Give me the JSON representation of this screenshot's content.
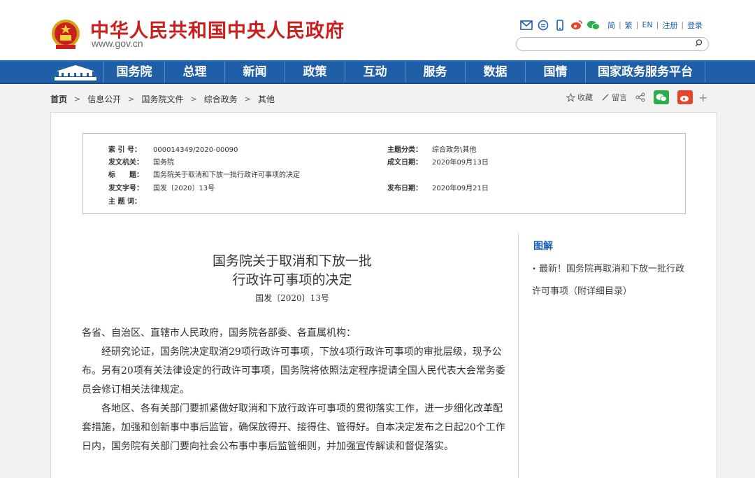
{
  "header": {
    "title": "中华人民共和国中央人民政府",
    "url": "www.gov.cn",
    "lang_links": [
      "简",
      "繁",
      "EN",
      "注册",
      "登录"
    ],
    "search_placeholder": ""
  },
  "nav": {
    "items": [
      "国务院",
      "总理",
      "新闻",
      "政策",
      "互动",
      "服务",
      "数据",
      "国情",
      "国家政务服务平台"
    ]
  },
  "breadcrumb": {
    "items": [
      "首页",
      "信息公开",
      "国务院文件",
      "综合政务",
      "其他"
    ]
  },
  "tools": {
    "favorite": "收藏",
    "comment": "留言"
  },
  "meta": {
    "index_no_label": "索 引 号：",
    "index_no": "000014349/2020-00090",
    "topic_label": "主题分类：",
    "topic": "综合政务\\其他",
    "issuer_label": "发文机关：",
    "issuer": "国务院",
    "date_label": "成文日期：",
    "date": "2020年09月13日",
    "title_label": "标　　题：",
    "title": "国务院关于取消和下放一批行政许可事项的决定",
    "doc_no_label": "发文字号：",
    "doc_no": "国发〔2020〕13号",
    "publish_label": "发布日期：",
    "publish": "2020年09月21日",
    "keywords_label": "主 题 词："
  },
  "doc": {
    "title_line1": "国务院关于取消和下放一批",
    "title_line2": "行政许可事项的决定",
    "number": "国发〔2020〕13号",
    "salutation": "各省、自治区、直辖市人民政府，国务院各部委、各直属机构：",
    "para1": "经研究论证，国务院决定取消29项行政许可事项，下放4项行政许可事项的审批层级，现予公布。另有20项有关法律设定的行政许可事项，国务院将依照法定程序提请全国人民代表大会常务委员会修订相关法律规定。",
    "para2": "各地区、各有关部门要抓紧做好取消和下放行政许可事项的贯彻落实工作，进一步细化改革配套措施，加强和创新事中事后监管，确保放得开、接得住、管得好。自本决定发布之日起20个工作日内，国务院有关部门要向社会公布事中事后监管细则，并加强宣传解读和督促落实。"
  },
  "sidebar": {
    "title": "图解",
    "link": "最新！国务院再取消和下放一批行政许可事项（附详细目录）"
  },
  "colors": {
    "brand_red": "#c9201e",
    "nav_blue": "#1f5fa8",
    "link_blue": "#1a5fb4"
  }
}
